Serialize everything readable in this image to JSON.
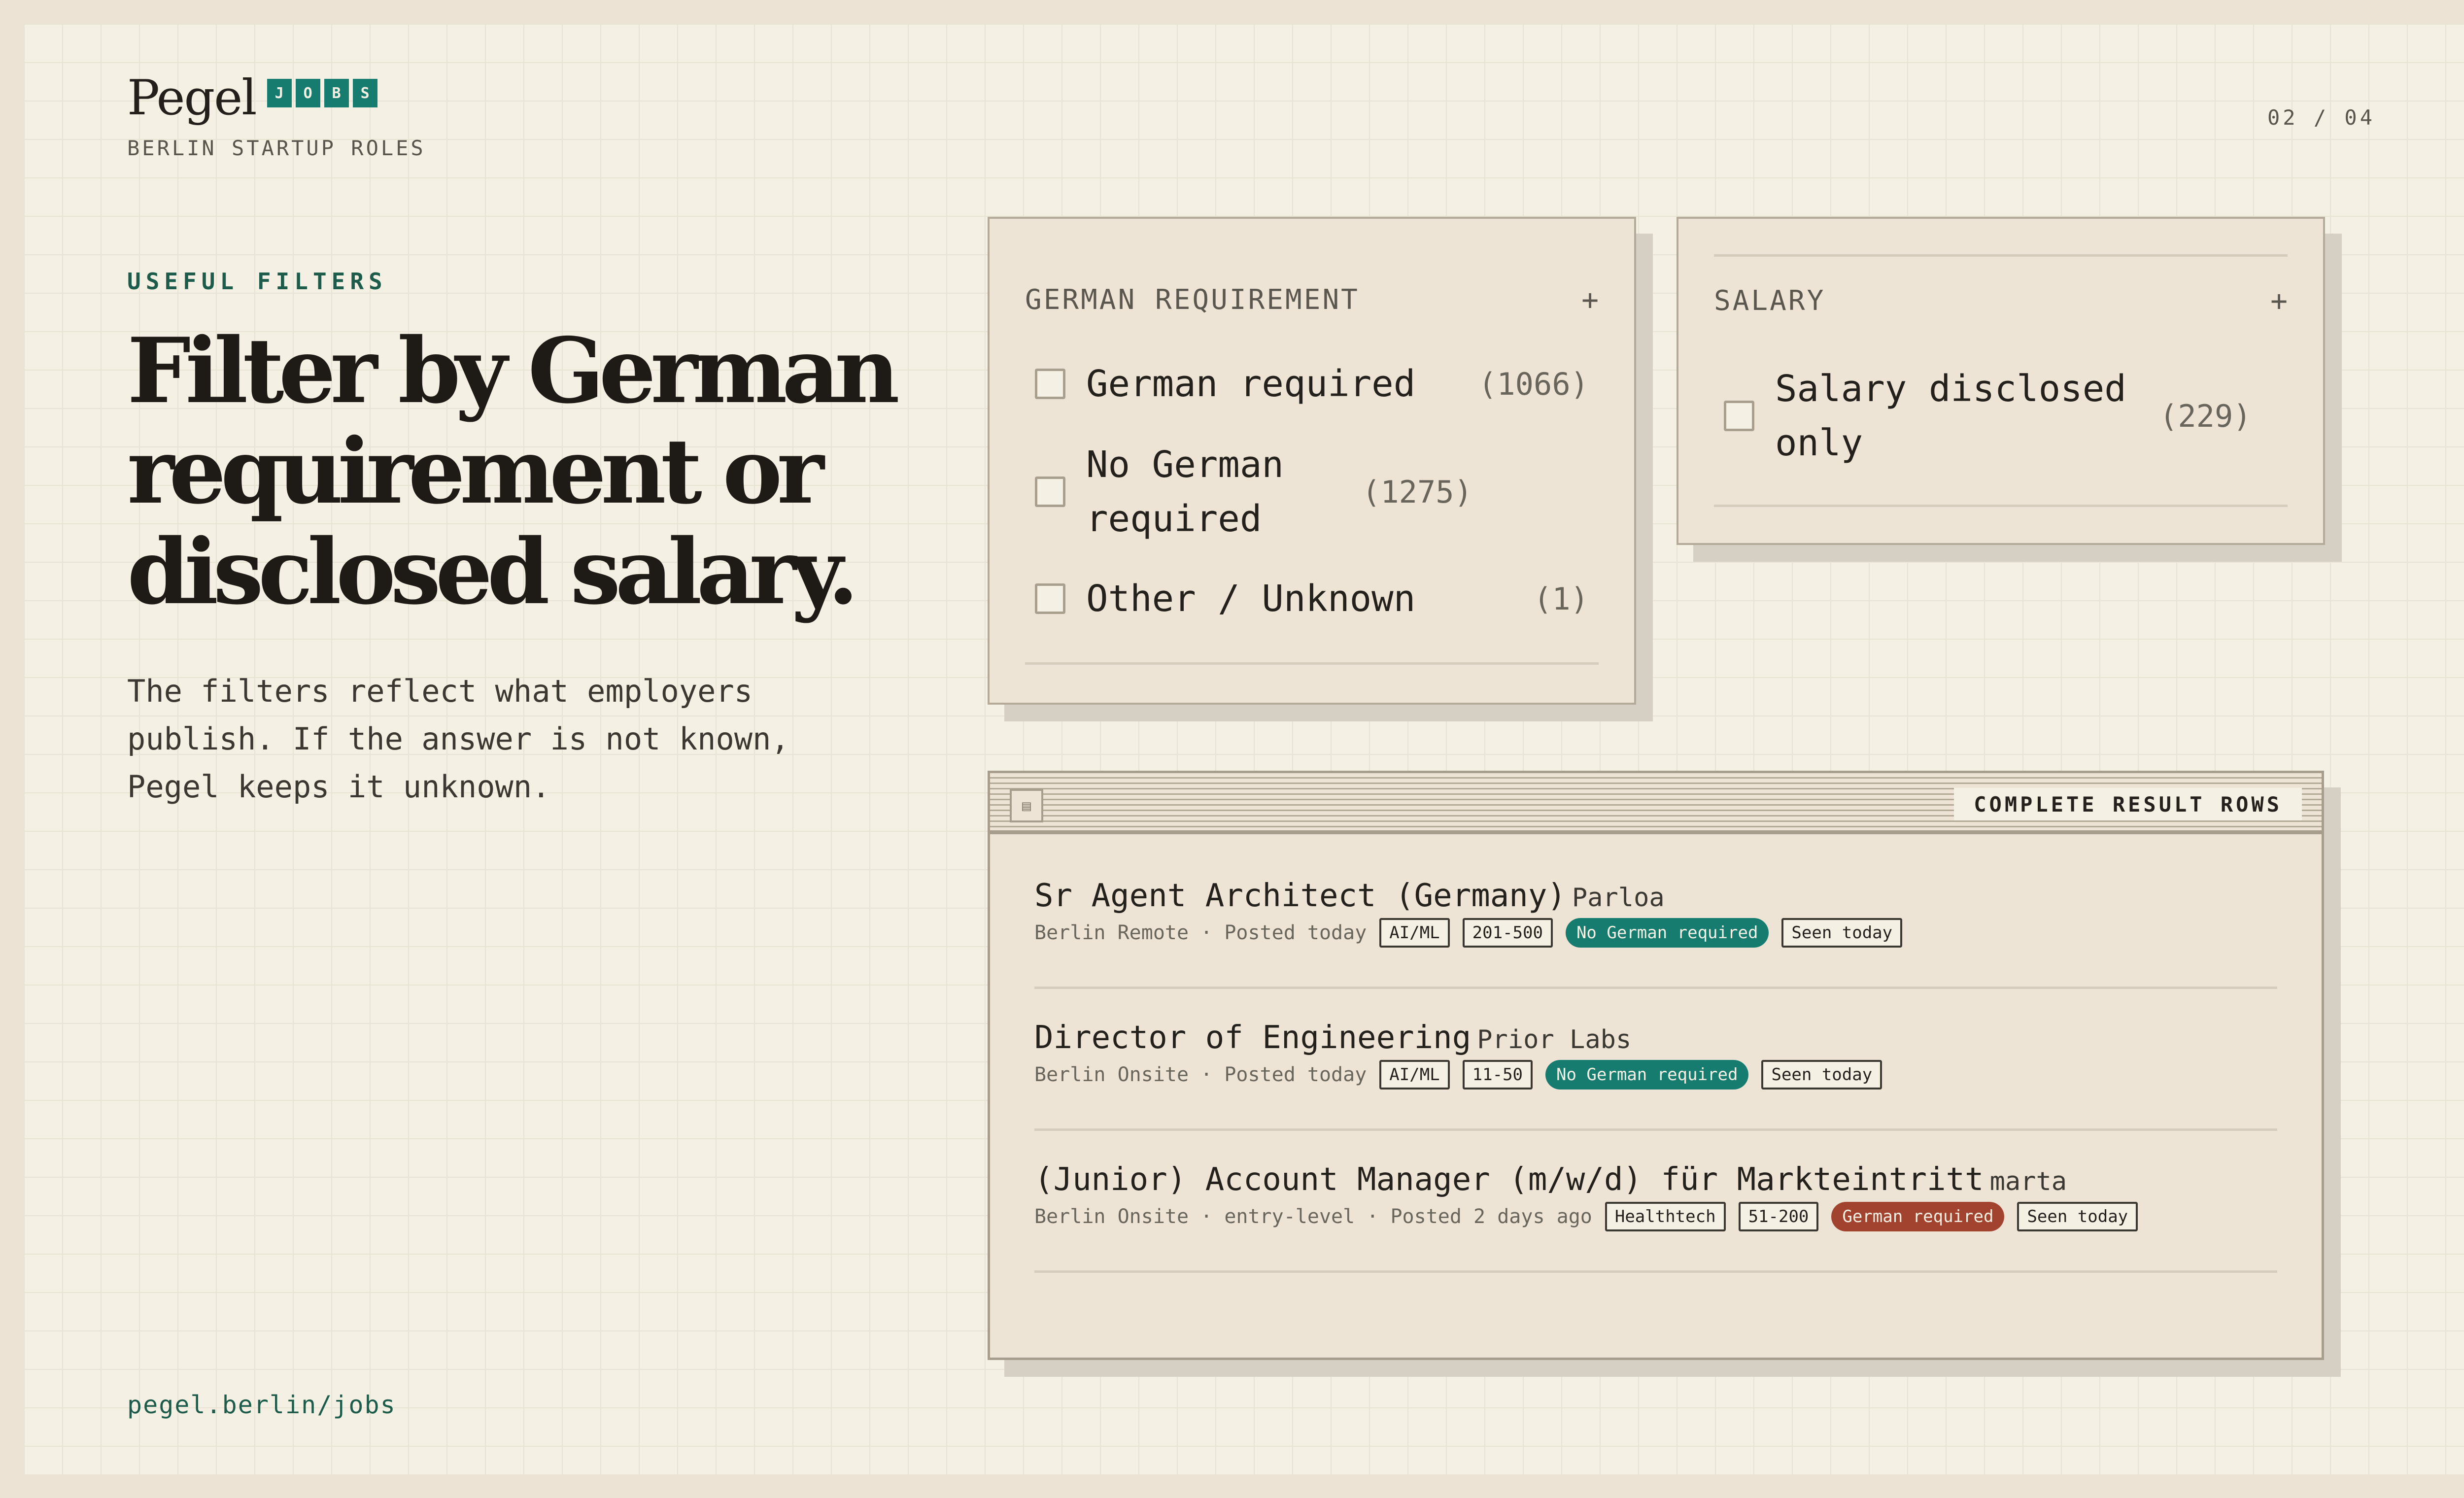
{
  "brand": {
    "name": "Pegel",
    "badge_letters": [
      "J",
      "O",
      "B",
      "S"
    ],
    "subtitle": "BERLIN STARTUP ROLES"
  },
  "page_indicator": "02 / 04",
  "hero": {
    "eyebrow": "USEFUL FILTERS",
    "headline": "Filter by German requirement or disclosed salary.",
    "lede": "The filters reflect what employers publish. If the answer is not known, Pegel keeps it unknown."
  },
  "footer": {
    "url": "pegel.berlin/jobs"
  },
  "filters": {
    "german": {
      "title": "GERMAN REQUIREMENT",
      "expand_icon": "+",
      "options": [
        {
          "label": "German required",
          "count": "(1066)"
        },
        {
          "label": "No German required",
          "count": "(1275)"
        },
        {
          "label": "Other / Unknown",
          "count": "(1)"
        }
      ]
    },
    "salary": {
      "title": "SALARY",
      "expand_icon": "+",
      "options": [
        {
          "label": "Salary disclosed only",
          "count": "(229)"
        }
      ]
    }
  },
  "results": {
    "window_icon": "▤",
    "window_title": "COMPLETE RESULT ROWS",
    "jobs": [
      {
        "role": "Sr Agent Architect (Germany)",
        "company": "Parloa",
        "meta": "Berlin Remote · Posted today",
        "tags": [
          "AI/ML",
          "201-500"
        ],
        "language": "No German required",
        "seen": "Seen today"
      },
      {
        "role": "Director of Engineering",
        "company": "Prior Labs",
        "meta": "Berlin Onsite · Posted today",
        "tags": [
          "AI/ML",
          "11-50"
        ],
        "language": "No German required",
        "seen": "Seen today"
      },
      {
        "role": "(Junior) Account Manager (m/w/d) für Markteintritt",
        "company": "marta",
        "meta": "Berlin Onsite · entry-level · Posted 2 days ago",
        "tags": [
          "Healthtech",
          "51-200"
        ],
        "language": "German required",
        "seen": "Seen today"
      }
    ]
  },
  "colors": {
    "teal": "#177c70",
    "red": "#a2432f",
    "paper": "#f5f0e4",
    "panel": "#ede4d6"
  }
}
